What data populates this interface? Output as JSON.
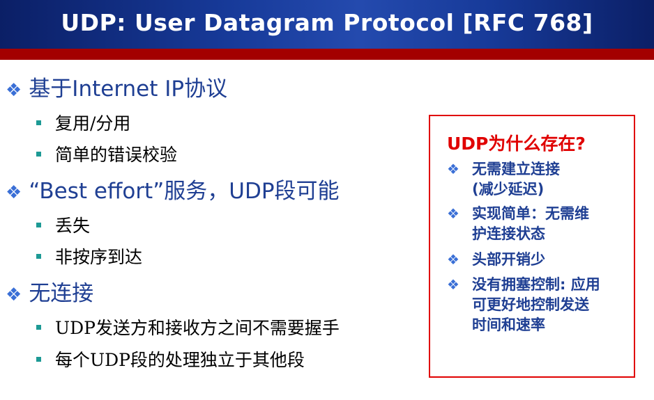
{
  "slide": {
    "title": "UDP: User Datagram Protocol [RFC 768]",
    "colors": {
      "header_blue": "#173a99",
      "header_red": "#a30000",
      "accent_red": "#e00000",
      "body_blue": "#1f3f93",
      "bullet_teal": "#1d9a95"
    },
    "icons": {
      "level1_bullet": "diamond-bullet-icon",
      "level2_bullet": "square-bullet-icon"
    },
    "points": [
      {
        "text": "基于Internet IP协议",
        "sub": [
          "复用/分用",
          "简单的错误校验"
        ]
      },
      {
        "text": "“Best effort”服务，UDP段可能",
        "sub": [
          "丢失",
          "非按序到达"
        ]
      },
      {
        "text": "无连接",
        "sub": [
          "UDP发送方和接收方之间不需要握手",
          "每个UDP段的处理独立于其他段"
        ]
      }
    ],
    "callout": {
      "title": "UDP为什么存在?",
      "items": [
        [
          "无需建立连接",
          "(减少延迟)"
        ],
        [
          "实现简单：无需维",
          "护连接状态"
        ],
        [
          "头部开销少"
        ],
        [
          "没有拥塞控制: 应用",
          "可更好地控制发送",
          "时间和速率"
        ]
      ]
    }
  }
}
